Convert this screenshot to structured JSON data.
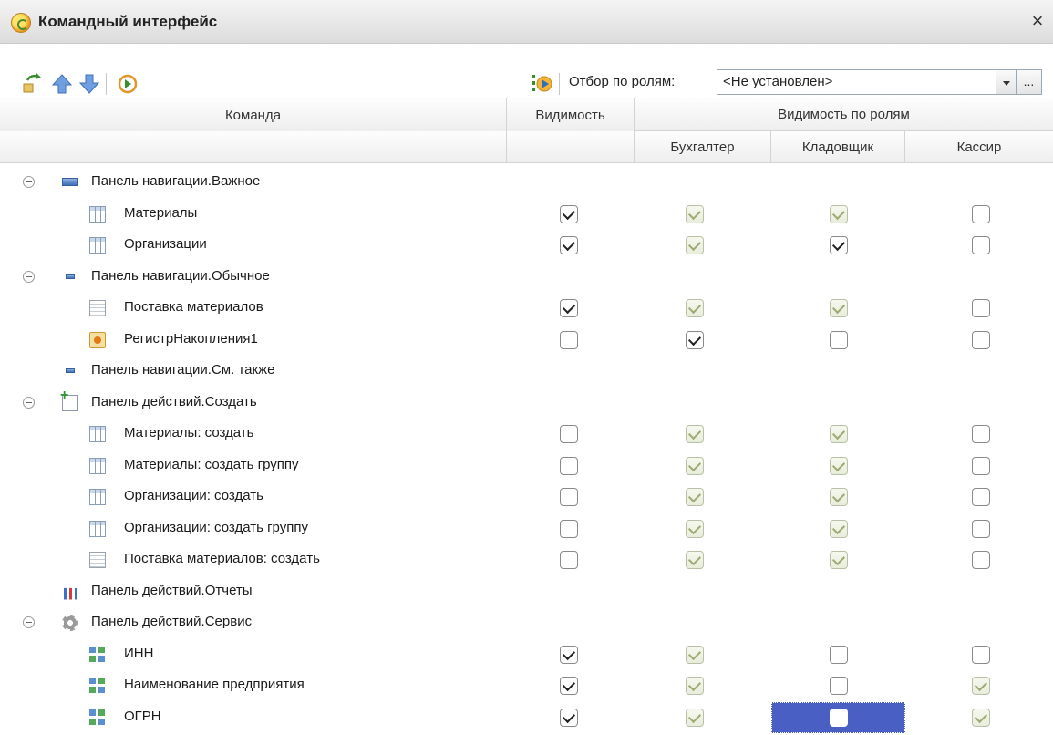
{
  "window": {
    "title": "Командный интерфейс",
    "close_label": "×"
  },
  "toolbar": {
    "filter_label": "Отбор по ролям:",
    "filter_value": "<Не установлен>",
    "dots_label": "..."
  },
  "columns": {
    "command": "Команда",
    "visibility": "Видимость",
    "visibility_by_roles": "Видимость по ролям",
    "roles": [
      "Бухгалтер",
      "Кладовщик",
      "Кассир"
    ]
  },
  "rows": [
    {
      "label": "Панель навигации.Важное",
      "icon": "navigation-panel-icon",
      "group": true
    },
    {
      "label": "Материалы",
      "icon": "catalog-table-icon",
      "vis": true,
      "roles": [
        true,
        true,
        false
      ],
      "role_disabled": [
        true,
        true,
        false
      ]
    },
    {
      "label": "Организации",
      "icon": "catalog-table-icon",
      "vis": true,
      "roles": [
        true,
        true,
        false
      ],
      "role_disabled": [
        true,
        false,
        false
      ]
    },
    {
      "label": "Панель навигации.Обычное",
      "icon": "navigation-panel-icon",
      "group": true
    },
    {
      "label": "Поставка материалов",
      "icon": "document-icon",
      "vis": true,
      "roles": [
        true,
        true,
        false
      ],
      "role_disabled": [
        true,
        true,
        false
      ]
    },
    {
      "label": "РегистрНакопления1",
      "icon": "accumulation-register-icon",
      "vis": false,
      "roles": [
        true,
        false,
        false
      ],
      "role_disabled": [
        false,
        false,
        false
      ]
    },
    {
      "label": "Панель навигации.См. также",
      "icon": "navigation-panel-icon",
      "group": true
    },
    {
      "label": "Панель действий.Создать",
      "icon": "create-action-icon",
      "group": true
    },
    {
      "label": "Материалы: создать",
      "icon": "catalog-table-icon",
      "vis": false,
      "roles": [
        true,
        true,
        false
      ],
      "role_disabled": [
        true,
        true,
        false
      ]
    },
    {
      "label": "Материалы: создать группу",
      "icon": "catalog-table-icon",
      "vis": false,
      "roles": [
        true,
        true,
        false
      ],
      "role_disabled": [
        true,
        true,
        false
      ]
    },
    {
      "label": "Организации: создать",
      "icon": "catalog-table-icon",
      "vis": false,
      "roles": [
        true,
        true,
        false
      ],
      "role_disabled": [
        true,
        true,
        false
      ]
    },
    {
      "label": "Организации: создать группу",
      "icon": "catalog-table-icon",
      "vis": false,
      "roles": [
        true,
        true,
        false
      ],
      "role_disabled": [
        true,
        true,
        false
      ]
    },
    {
      "label": "Поставка материалов: создать",
      "icon": "document-icon",
      "vis": false,
      "roles": [
        true,
        true,
        false
      ],
      "role_disabled": [
        true,
        true,
        false
      ]
    },
    {
      "label": "Панель действий.Отчеты",
      "icon": "reports-icon",
      "group": true
    },
    {
      "label": "Панель действий.Сервис",
      "icon": "service-gear-icon",
      "group": true
    },
    {
      "label": "ИНН",
      "icon": "attribute-icon",
      "vis": true,
      "roles": [
        true,
        false,
        false
      ],
      "role_disabled": [
        true,
        false,
        false
      ]
    },
    {
      "label": "Наименование предприятия",
      "icon": "attribute-icon",
      "vis": true,
      "roles": [
        true,
        false,
        true
      ],
      "role_disabled": [
        true,
        false,
        true
      ]
    },
    {
      "label": "ОГРН",
      "icon": "attribute-icon",
      "vis": true,
      "roles": [
        true,
        false,
        true
      ],
      "role_disabled": [
        true,
        false,
        true
      ],
      "selected_role": 1
    }
  ]
}
